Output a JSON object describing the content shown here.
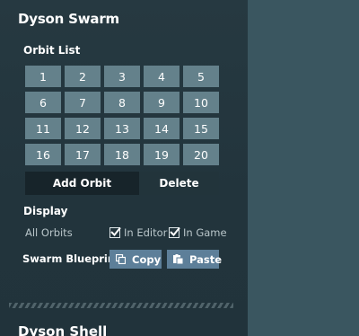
{
  "panel": {
    "title": "Dyson Swarm",
    "orbit_list_label": "Orbit List",
    "orbits": [
      "1",
      "2",
      "3",
      "4",
      "5",
      "6",
      "7",
      "8",
      "9",
      "10",
      "11",
      "12",
      "13",
      "14",
      "15",
      "16",
      "17",
      "18",
      "19",
      "20"
    ],
    "add_orbit_label": "Add Orbit",
    "delete_label": "Delete",
    "display_label": "Display",
    "all_orbits_label": "All Orbits",
    "in_editor_label": "In Editor",
    "in_editor_checked": true,
    "in_game_label": "In Game",
    "in_game_checked": true,
    "swarm_blueprint_label": "Swarm Blueprint",
    "copy_label": "Copy",
    "paste_label": "Paste",
    "next_section_title": "Dyson Shell"
  },
  "colors": {
    "panel_bg": "#22343c",
    "orbit_button": "#64818b",
    "blueprint_button": "#5d7f99",
    "selected_dark": "#17242a"
  },
  "icons": {
    "copy": "copy-icon",
    "paste": "paste-icon",
    "check": "checkbox-check-icon"
  }
}
